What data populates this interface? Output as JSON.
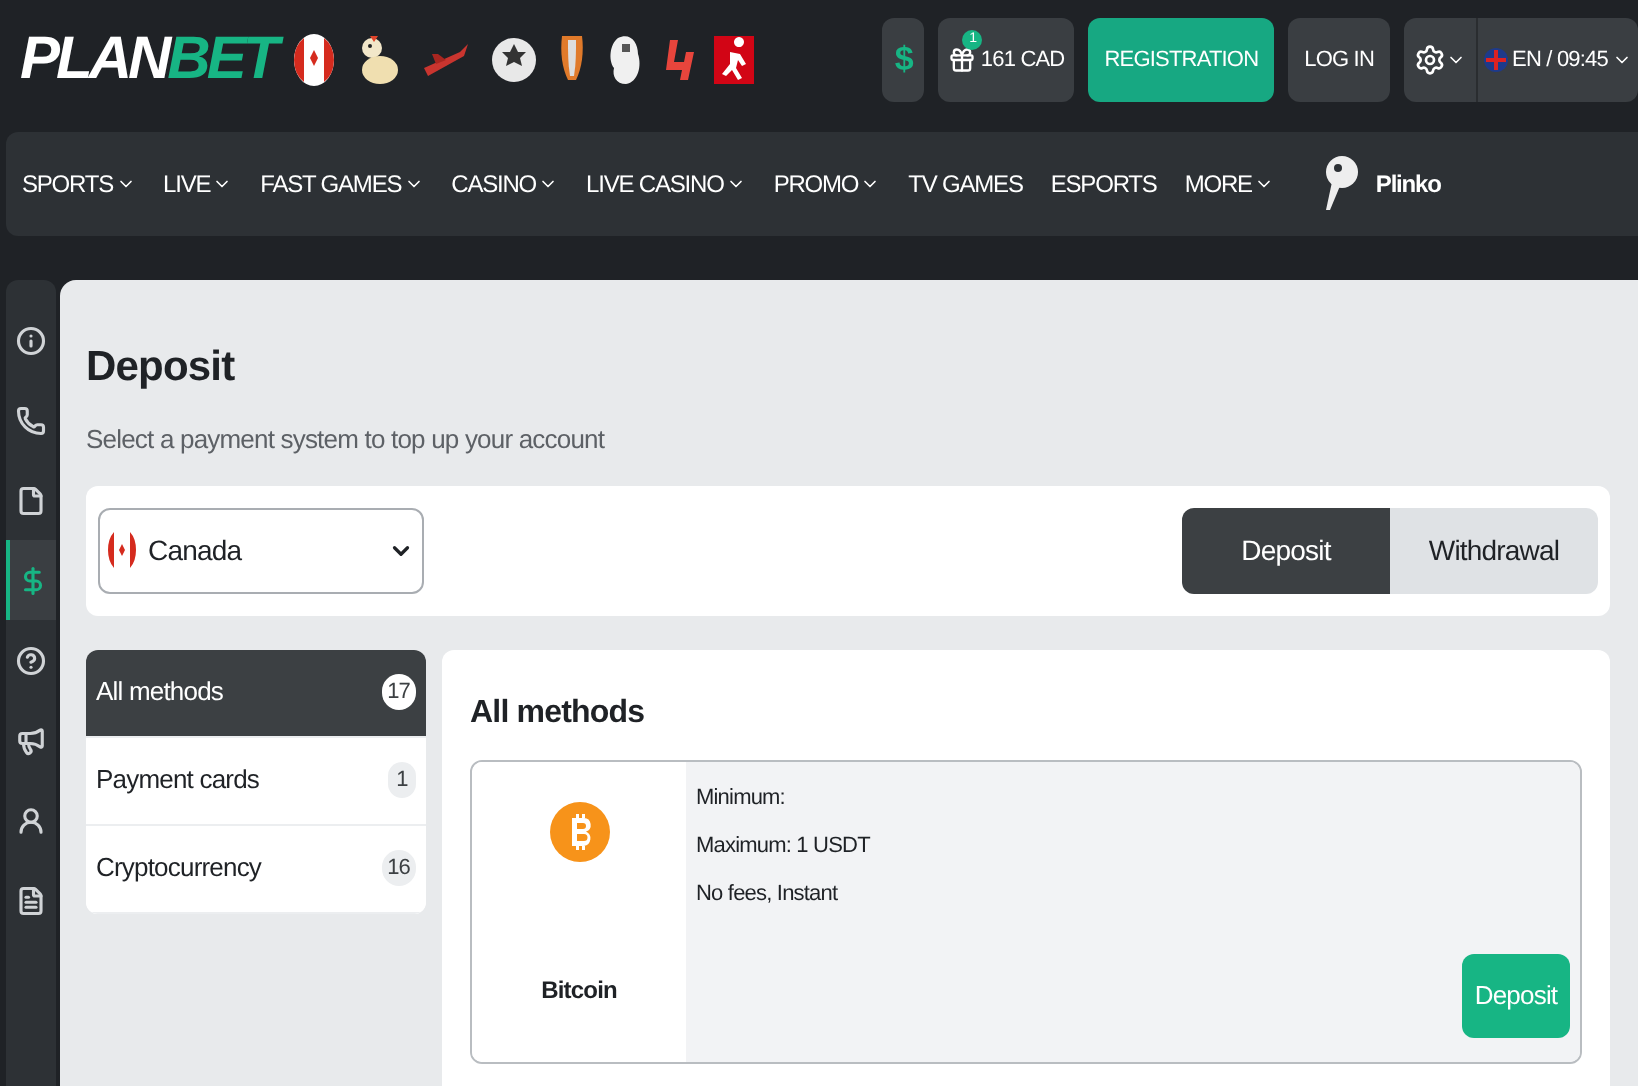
{
  "header": {
    "logo": {
      "first": "PLAN",
      "second": "BET"
    },
    "currency_button": "$",
    "bonus": {
      "badge": "1",
      "label": "161 CAD"
    },
    "register_button": "REGISTRATION",
    "login_button": "LOG IN",
    "language": "EN / 09:45"
  },
  "nav": [
    {
      "label": "SPORTS",
      "dropdown": true
    },
    {
      "label": "LIVE",
      "dropdown": true
    },
    {
      "label": "FAST GAMES",
      "dropdown": true
    },
    {
      "label": "CASINO",
      "dropdown": true
    },
    {
      "label": "LIVE CASINO",
      "dropdown": true
    },
    {
      "label": "PROMO",
      "dropdown": true
    },
    {
      "label": "TV GAMES",
      "dropdown": false
    },
    {
      "label": "ESPORTS",
      "dropdown": false
    },
    {
      "label": "MORE",
      "dropdown": true
    },
    {
      "label": "Plinko",
      "dropdown": false,
      "kind": "game"
    }
  ],
  "sidebar": [
    {
      "selected": false
    },
    {
      "selected": false
    },
    {
      "selected": false
    },
    {
      "selected": true
    },
    {
      "selected": false
    },
    {
      "selected": false
    },
    {
      "selected": false
    },
    {
      "selected": false
    }
  ],
  "page": {
    "title": "Deposit",
    "subtitle": "Select a payment system to top up your account",
    "country": "Canada",
    "tabs": [
      {
        "label": "Deposit",
        "selected": true
      },
      {
        "label": "Withdrawal",
        "selected": false
      }
    ],
    "categories": [
      {
        "label": "All methods",
        "count": "17",
        "selected": true
      },
      {
        "label": "Payment cards",
        "count": "1",
        "selected": false
      },
      {
        "label": "Cryptocurrency",
        "count": "16",
        "selected": false
      }
    ],
    "methods_title": "All methods",
    "methods": [
      {
        "name": "Bitcoin",
        "lines": [
          "Minimum:",
          "Maximum: 1 USDT",
          "No fees, Instant"
        ],
        "button": "Deposit"
      }
    ]
  }
}
